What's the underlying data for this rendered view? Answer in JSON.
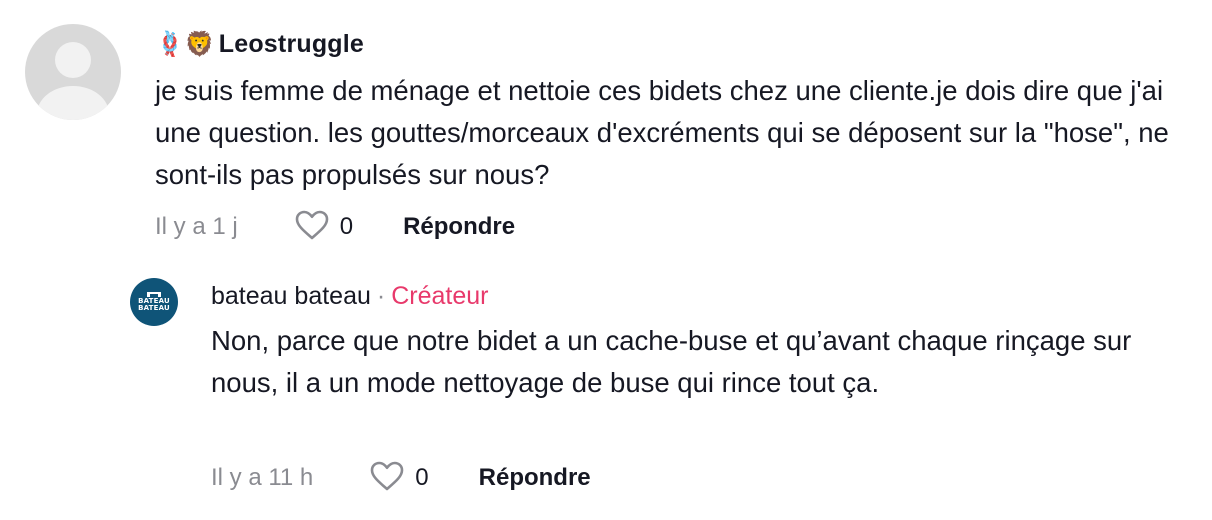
{
  "comment": {
    "username": "Leostruggle",
    "emoji_decor": "🪢🦁",
    "text": "je suis femme de ménage et nettoie ces bidets chez une cliente.je dois dire que j'ai une question. les gouttes/morceaux d'excréments qui se déposent sur la \"hose\", ne sont-ils pas propulsés sur nous?",
    "timestamp": "Il y a 1 j",
    "like_count": "0",
    "reply_label": "Répondre"
  },
  "reply": {
    "username": "bateau bateau",
    "separator": "·",
    "badge": "Créateur",
    "avatar_text_line1": "BATEAU",
    "avatar_text_line2": "BATEAU",
    "text": "Non, parce que notre bidet a un cache-buse et qu’avant chaque rinçage sur nous, il a un mode nettoyage de buse qui rince tout ça.",
    "timestamp": "Il y a 11 h",
    "like_count": "0",
    "reply_label": "Répondre"
  },
  "colors": {
    "text": "#161823",
    "muted": "#8a8b91",
    "creator_badge": "#e8396b",
    "creator_avatar": "#0f5478",
    "placeholder_avatar": "#d9d9d9"
  },
  "icons": {
    "like": "heart-outline-icon",
    "avatar_placeholder": "person-silhouette-icon"
  }
}
